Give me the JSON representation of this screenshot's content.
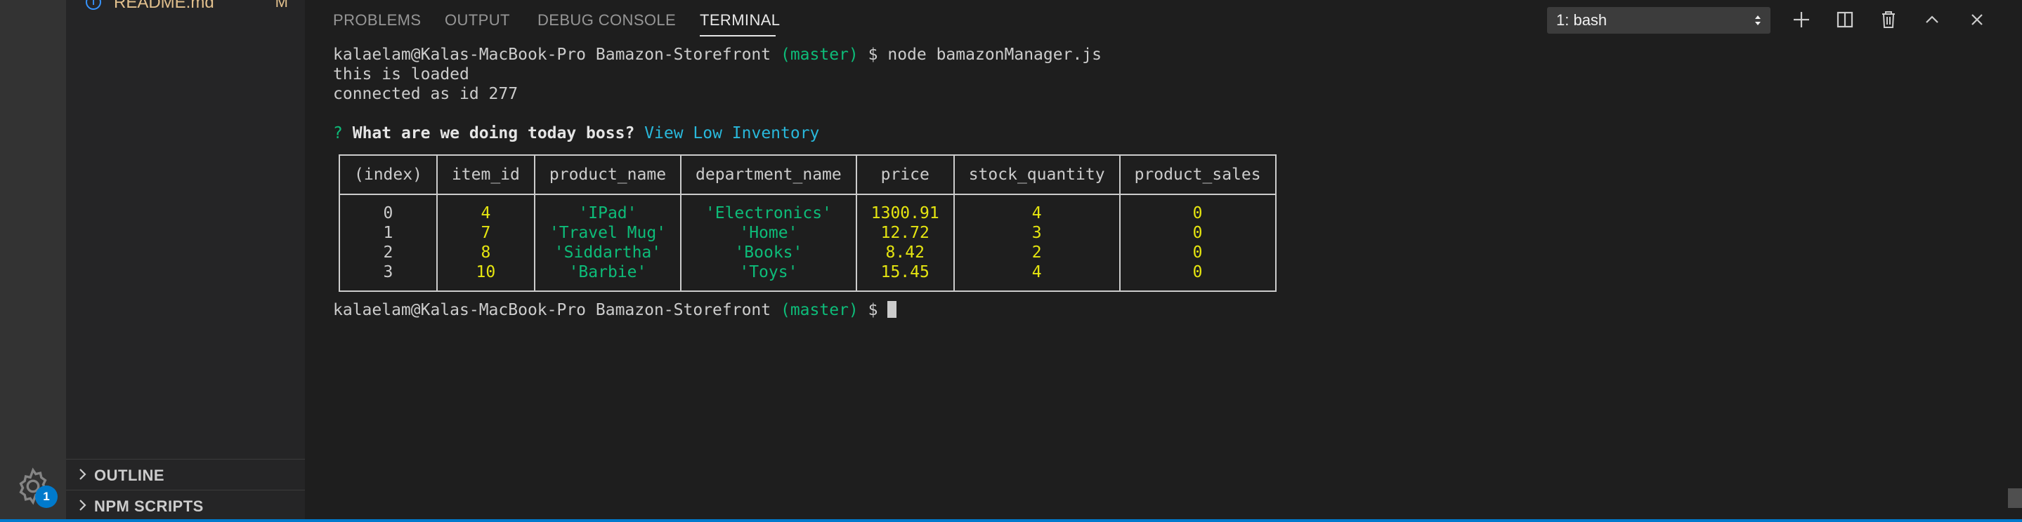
{
  "sidebar": {
    "file": {
      "name": "README.md",
      "status": "M",
      "icon": "info-icon"
    },
    "sections": [
      {
        "label": "OUTLINE",
        "icon": "chevron-right-icon"
      },
      {
        "label": "NPM SCRIPTS",
        "icon": "chevron-right-icon"
      }
    ]
  },
  "activity_bar": {
    "manage_icon": "gear-icon",
    "badge_count": "1"
  },
  "panel": {
    "tabs": [
      "PROBLEMS",
      "OUTPUT",
      "DEBUG CONSOLE",
      "TERMINAL"
    ],
    "active_tab": "TERMINAL",
    "terminal_select": "1: bash",
    "actions": [
      "plus-icon",
      "split-icon",
      "trash-icon",
      "chevron-up-icon",
      "close-icon"
    ]
  },
  "terminal": {
    "prompt_user": "kalaelam@Kalas-MacBook-Pro Bamazon-Storefront",
    "branch": "(master)",
    "prompt_symbol": "$",
    "command": "node bamazonManager.js",
    "out_line1": "this is loaded",
    "out_line2": "connected as id 277",
    "question_mark": "?",
    "question": "What are we doing today boss?",
    "answer": "View Low Inventory",
    "table": {
      "headers": [
        "(index)",
        "item_id",
        "product_name",
        "department_name",
        "price",
        "stock_quantity",
        "product_sales"
      ],
      "rows": [
        [
          "0",
          "4",
          "'IPad'",
          "'Electronics'",
          "1300.91",
          "4",
          "0"
        ],
        [
          "1",
          "7",
          "'Travel Mug'",
          "'Home'",
          "12.72",
          "3",
          "0"
        ],
        [
          "2",
          "8",
          "'Siddartha'",
          "'Books'",
          "8.42",
          "2",
          "0"
        ],
        [
          "3",
          "10",
          "'Barbie'",
          "'Toys'",
          "15.45",
          "4",
          "0"
        ]
      ]
    }
  },
  "colors": {
    "accent": "#007acc",
    "green": "#23d18b",
    "yellow": "#e5e510",
    "cyan": "#29b8db"
  }
}
